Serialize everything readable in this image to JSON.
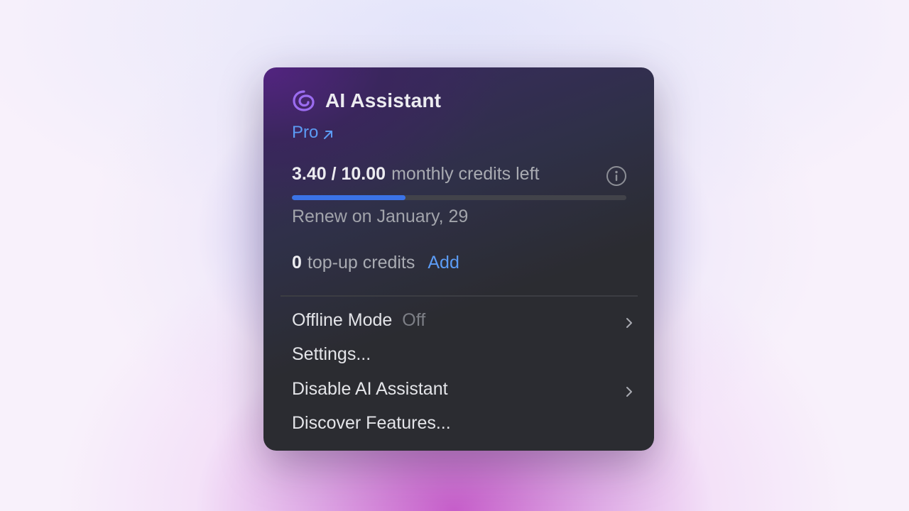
{
  "header": {
    "title": "AI Assistant",
    "plan_link": "Pro"
  },
  "credits": {
    "amount": "3.40 / 10.00",
    "label": "monthly credits left",
    "used_fraction": 0.34,
    "renew_text": "Renew on January, 29"
  },
  "topup": {
    "amount": "0",
    "label": "top-up credits",
    "add_label": "Add"
  },
  "menu": {
    "items": [
      {
        "label": "Offline Mode",
        "value": "Off",
        "has_submenu": true
      },
      {
        "label": "Settings...",
        "has_submenu": false
      },
      {
        "label": "Disable AI Assistant",
        "has_submenu": true
      },
      {
        "label": "Discover Features...",
        "has_submenu": false
      }
    ]
  },
  "colors": {
    "accent_link": "#5c9cf5",
    "progress_fill": "#3b73e6",
    "logo": "#9b6cf0"
  },
  "icons": {
    "logo": "ai-spiral-icon",
    "pro_link": "arrow-up-right-icon",
    "info": "info-icon",
    "submenu": "chevron-right-icon"
  }
}
